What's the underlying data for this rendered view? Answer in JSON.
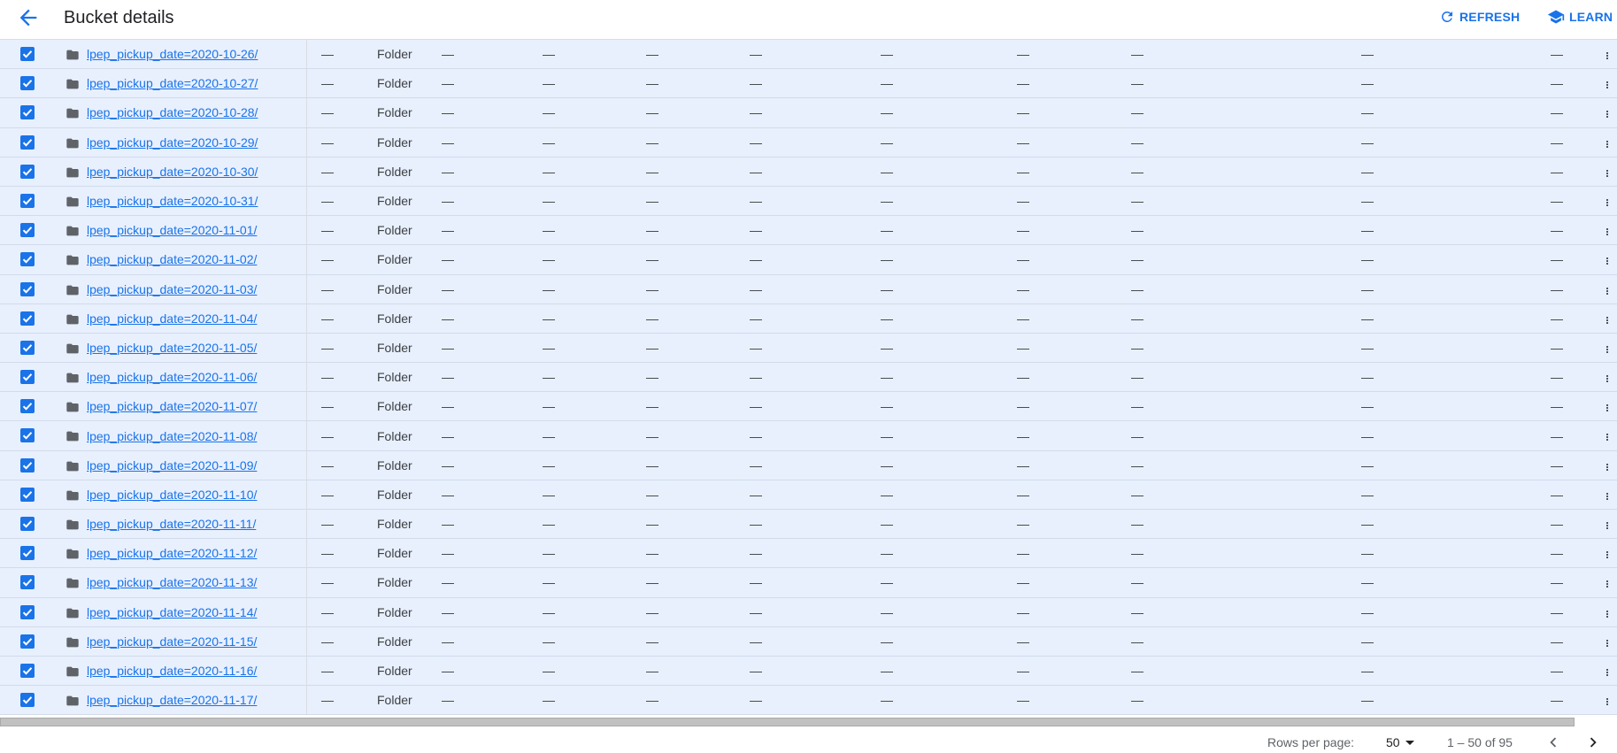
{
  "header": {
    "title": "Bucket details",
    "refresh_label": "REFRESH",
    "learn_label": "LEARN"
  },
  "colors": {
    "accent": "#1a73e8",
    "row_selected": "#e8f0fe"
  },
  "table": {
    "rows": [
      {
        "name": "lpep_pickup_date=2020-10-26/",
        "type": "Folder",
        "empty": "—"
      },
      {
        "name": "lpep_pickup_date=2020-10-27/",
        "type": "Folder",
        "empty": "—"
      },
      {
        "name": "lpep_pickup_date=2020-10-28/",
        "type": "Folder",
        "empty": "—"
      },
      {
        "name": "lpep_pickup_date=2020-10-29/",
        "type": "Folder",
        "empty": "—"
      },
      {
        "name": "lpep_pickup_date=2020-10-30/",
        "type": "Folder",
        "empty": "—"
      },
      {
        "name": "lpep_pickup_date=2020-10-31/",
        "type": "Folder",
        "empty": "—"
      },
      {
        "name": "lpep_pickup_date=2020-11-01/",
        "type": "Folder",
        "empty": "—"
      },
      {
        "name": "lpep_pickup_date=2020-11-02/",
        "type": "Folder",
        "empty": "—"
      },
      {
        "name": "lpep_pickup_date=2020-11-03/",
        "type": "Folder",
        "empty": "—"
      },
      {
        "name": "lpep_pickup_date=2020-11-04/",
        "type": "Folder",
        "empty": "—"
      },
      {
        "name": "lpep_pickup_date=2020-11-05/",
        "type": "Folder",
        "empty": "—"
      },
      {
        "name": "lpep_pickup_date=2020-11-06/",
        "type": "Folder",
        "empty": "—"
      },
      {
        "name": "lpep_pickup_date=2020-11-07/",
        "type": "Folder",
        "empty": "—"
      },
      {
        "name": "lpep_pickup_date=2020-11-08/",
        "type": "Folder",
        "empty": "—"
      },
      {
        "name": "lpep_pickup_date=2020-11-09/",
        "type": "Folder",
        "empty": "—"
      },
      {
        "name": "lpep_pickup_date=2020-11-10/",
        "type": "Folder",
        "empty": "—"
      },
      {
        "name": "lpep_pickup_date=2020-11-11/",
        "type": "Folder",
        "empty": "—"
      },
      {
        "name": "lpep_pickup_date=2020-11-12/",
        "type": "Folder",
        "empty": "—"
      },
      {
        "name": "lpep_pickup_date=2020-11-13/",
        "type": "Folder",
        "empty": "—"
      },
      {
        "name": "lpep_pickup_date=2020-11-14/",
        "type": "Folder",
        "empty": "—"
      },
      {
        "name": "lpep_pickup_date=2020-11-15/",
        "type": "Folder",
        "empty": "—"
      },
      {
        "name": "lpep_pickup_date=2020-11-16/",
        "type": "Folder",
        "empty": "—"
      },
      {
        "name": "lpep_pickup_date=2020-11-17/",
        "type": "Folder",
        "empty": "—"
      }
    ]
  },
  "pagination": {
    "rows_per_page_label": "Rows per page:",
    "rows_per_page_value": "50",
    "range": "1 – 50 of 95"
  }
}
